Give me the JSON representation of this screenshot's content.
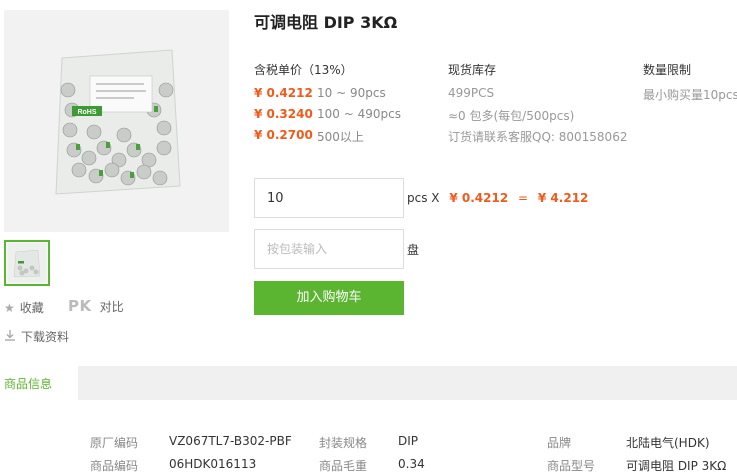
{
  "product": {
    "title": "可调电阻 DIP 3KΩ"
  },
  "side": {
    "favorite": "收藏",
    "pk": "PK",
    "compare": "对比",
    "download": "下载资料"
  },
  "photo": {
    "rohs": "RoHS"
  },
  "pricing": {
    "header": "含税单价（13%）",
    "tiers": [
      {
        "price": "¥ 0.4212",
        "range": "10 ~ 90pcs"
      },
      {
        "price": "¥ 0.3240",
        "range": "100 ~ 490pcs"
      },
      {
        "price": "¥ 0.2700",
        "range": "500以上"
      }
    ]
  },
  "stock": {
    "header": "现货库存",
    "count": "499PCS",
    "packs": "≈0 包多(每包/500pcs)",
    "contact": "订货请联系客服QQ: 800158062"
  },
  "limit": {
    "header": "数量限制",
    "text": "最小购买量10pcs"
  },
  "order": {
    "quantity": "10",
    "unit": "pcs X",
    "unit_price": "¥ 0.4212",
    "equals": "=",
    "total": "¥ 4.212",
    "package_placeholder": "按包装输入",
    "package_unit": "盘",
    "cart_button": "加入购物车"
  },
  "tabs": {
    "info": "商品信息"
  },
  "specs": {
    "row1": {
      "k1": "原厂编码",
      "v1": "VZ067TL7-B302-PBF",
      "k2": "封装规格",
      "v2": "DIP",
      "k3": "品牌",
      "v3": "北陆电气(HDK)"
    },
    "row2": {
      "k1": "商品编码",
      "v1": "06HDK016113",
      "k2": "商品毛重",
      "v2": "0.34",
      "k3": "商品型号",
      "v3": "可调电阻 DIP 3KΩ"
    }
  },
  "colors": {
    "accent_green": "#5cb531",
    "price_orange": "#f05a1a"
  },
  "icons": [
    "star-icon",
    "download-icon"
  ]
}
